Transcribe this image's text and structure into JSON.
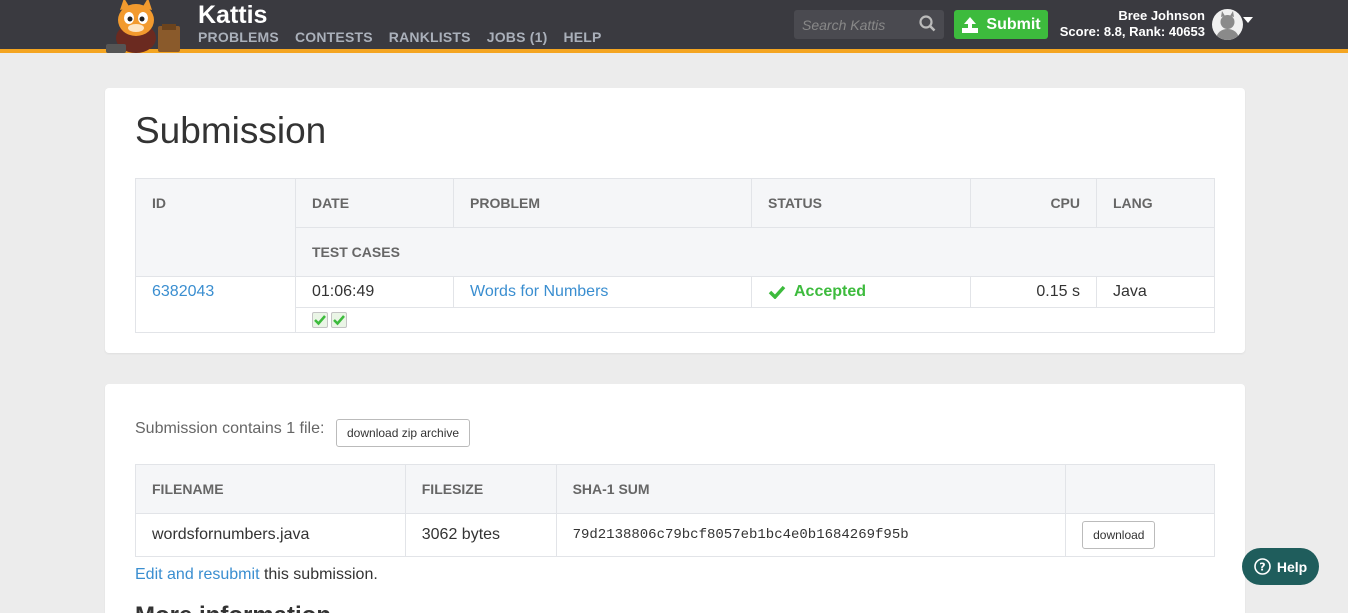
{
  "header": {
    "brand": "Kattis",
    "nav": [
      "PROBLEMS",
      "CONTESTS",
      "RANKLISTS",
      "JOBS (1)",
      "HELP"
    ],
    "search_placeholder": "Search Kattis",
    "submit_label": "Submit",
    "user_name": "Bree Johnson",
    "user_stats": "Score: 8.8, Rank: 40653"
  },
  "submission": {
    "title": "Submission",
    "columns": [
      "ID",
      "DATE",
      "PROBLEM",
      "STATUS",
      "CPU",
      "LANG"
    ],
    "subheader": "TEST CASES",
    "row": {
      "id": "6382043",
      "date": "01:06:49",
      "problem": "Words for Numbers",
      "status": "Accepted",
      "cpu": "0.15 s",
      "lang": "Java"
    },
    "test_cases_passed": 2
  },
  "files": {
    "note": "Submission contains 1 file:",
    "zip_label": "download zip archive",
    "columns": [
      "FILENAME",
      "FILESIZE",
      "SHA-1 SUM",
      ""
    ],
    "row": {
      "filename": "wordsfornumbers.java",
      "filesize": "3062 bytes",
      "sha1": "79d2138806c79bcf8057eb1bc4e0b1684269f95b",
      "download_label": "download"
    },
    "edit_link": "Edit and resubmit",
    "edit_suffix": " this submission.",
    "more_title": "More information"
  },
  "help_label": "Help",
  "colors": {
    "header_bg": "#3a3a40",
    "accent_bar": "#f4a521",
    "green": "#3dbb3d",
    "link": "#3a8ed0",
    "help_bg": "#1f5d5c"
  }
}
